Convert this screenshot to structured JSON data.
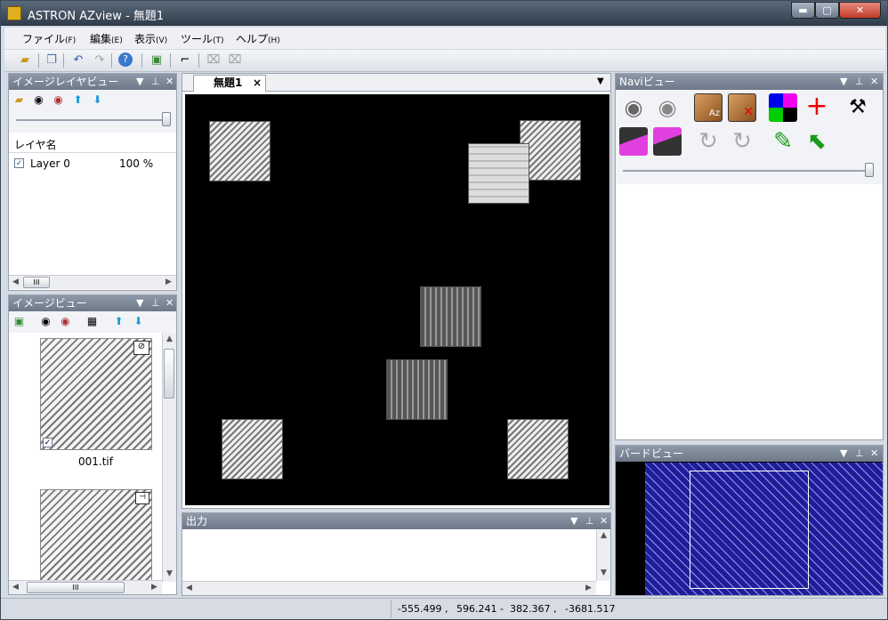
{
  "window": {
    "title": "ASTRON AZview - 無題1",
    "min_label": "▬",
    "max_label": "▢",
    "close_label": "✕"
  },
  "menu": [
    {
      "label": "ファイル",
      "key": "(F)"
    },
    {
      "label": "編集",
      "key": "(E)"
    },
    {
      "label": "表示",
      "key": "(V)"
    },
    {
      "label": "ツール",
      "key": "(T)"
    },
    {
      "label": "ヘルプ",
      "key": "(H)"
    }
  ],
  "toolbar_icons": [
    "open-folder-icon",
    "copy-icon",
    "undo-icon",
    "redo-icon",
    "help-icon",
    "add-image-icon",
    "ruler-icon",
    "remove-ruler-icon",
    "remove-all-icon"
  ],
  "layer_view": {
    "title": "イメージレイヤビュー",
    "column": "レイヤ名",
    "layers": [
      {
        "name": "Layer 0",
        "opacity": "100 %",
        "checked": true
      }
    ],
    "hscroll": "III"
  },
  "image_view": {
    "title": "イメージビュー",
    "thumbs": [
      {
        "name": "001.tif"
      }
    ],
    "hscroll": "III"
  },
  "document": {
    "tab": "無題1",
    "tab_close": "×"
  },
  "output": {
    "title": "出力"
  },
  "navi": {
    "title": "Naviビュー",
    "az_label": "Az"
  },
  "bird": {
    "title": "バードビュー"
  },
  "status": {
    "x1": "-555.499 ,",
    "y1": "596.241 -",
    "x2": "382.367 ,",
    "y2": "-3681.517"
  },
  "colors": {
    "titlebar": "#2e3b4a",
    "panel_header": "#7a8696",
    "canvas": "#000000",
    "bird_bg": "#1e1e9c"
  }
}
